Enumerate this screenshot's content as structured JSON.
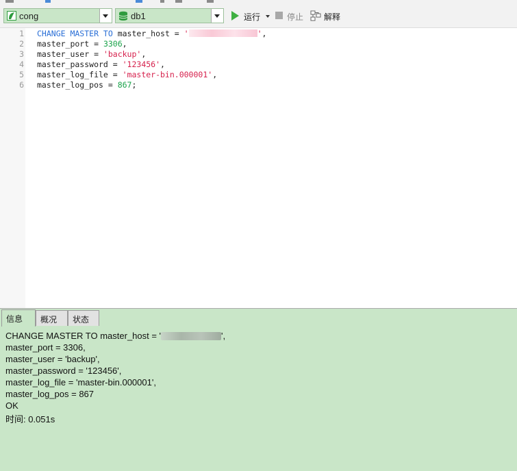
{
  "toolbar": {
    "connection": {
      "value": "cong",
      "icon": "connection-icon"
    },
    "database": {
      "value": "db1",
      "icon": "database-icon"
    },
    "run_label": "运行",
    "stop_label": "停止",
    "explain_label": "解释"
  },
  "editor": {
    "lines": [
      {
        "num": "1",
        "parts": [
          {
            "t": "CHANGE MASTER TO",
            "c": "kw"
          },
          {
            "t": " master_host = "
          },
          {
            "t": "'",
            "c": "str"
          },
          {
            "t": "",
            "c": "redact"
          },
          {
            "t": "'",
            "c": "str"
          },
          {
            "t": ","
          }
        ]
      },
      {
        "num": "2",
        "parts": [
          {
            "t": "master_port = "
          },
          {
            "t": "3306",
            "c": "num"
          },
          {
            "t": ","
          }
        ]
      },
      {
        "num": "3",
        "parts": [
          {
            "t": "master_user = "
          },
          {
            "t": "'backup'",
            "c": "str"
          },
          {
            "t": ","
          }
        ]
      },
      {
        "num": "4",
        "parts": [
          {
            "t": "master_password = "
          },
          {
            "t": "'123456'",
            "c": "str"
          },
          {
            "t": ","
          }
        ]
      },
      {
        "num": "5",
        "parts": [
          {
            "t": "master_log_file = "
          },
          {
            "t": "'master-bin.000001'",
            "c": "str"
          },
          {
            "t": ","
          }
        ]
      },
      {
        "num": "6",
        "parts": [
          {
            "t": "master_log_pos = "
          },
          {
            "t": "867",
            "c": "num"
          },
          {
            "t": ";"
          }
        ]
      }
    ]
  },
  "result": {
    "tabs": [
      "信息",
      "概况",
      "状态"
    ],
    "messages": [
      {
        "parts": [
          {
            "t": "CHANGE MASTER TO master_host = '"
          },
          {
            "t": "",
            "c": "redact"
          },
          {
            "t": "',"
          }
        ]
      },
      {
        "parts": [
          {
            "t": "master_port = 3306,"
          }
        ]
      },
      {
        "parts": [
          {
            "t": "master_user = 'backup',"
          }
        ]
      },
      {
        "parts": [
          {
            "t": "master_password = '123456',"
          }
        ]
      },
      {
        "parts": [
          {
            "t": "master_log_file = 'master-bin.000001',"
          }
        ]
      },
      {
        "parts": [
          {
            "t": "master_log_pos = 867"
          }
        ]
      },
      {
        "parts": [
          {
            "t": "OK"
          }
        ]
      },
      {
        "parts": [
          {
            "t": "时间: 0.051s"
          }
        ]
      }
    ]
  },
  "colors": {
    "result_bg": "#c9e6c8",
    "keyword": "#2a6fd6",
    "number": "#1aa34a",
    "string": "#d6204c",
    "run_green": "#3fb042"
  }
}
